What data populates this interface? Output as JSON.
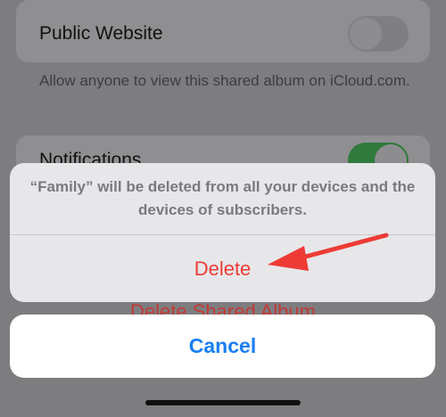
{
  "settings": {
    "public_website_label": "Public Website",
    "public_website_enabled": false,
    "public_website_footnote": "Allow anyone to view this shared album on iCloud.com.",
    "notifications_label": "Notifications",
    "notifications_enabled": true,
    "delete_shared_album_label": "Delete Shared Album"
  },
  "action_sheet": {
    "message": "“Family” will be deleted from all your devices and the devices of subscribers.",
    "delete_label": "Delete",
    "cancel_label": "Cancel"
  },
  "colors": {
    "destructive": "#ef3b36",
    "cancel": "#1a7ef5",
    "annotation_arrow": "#ef3b36",
    "toggle_on": "#34c759"
  },
  "annotation": {
    "icon": "red-arrow-pointing-left"
  }
}
